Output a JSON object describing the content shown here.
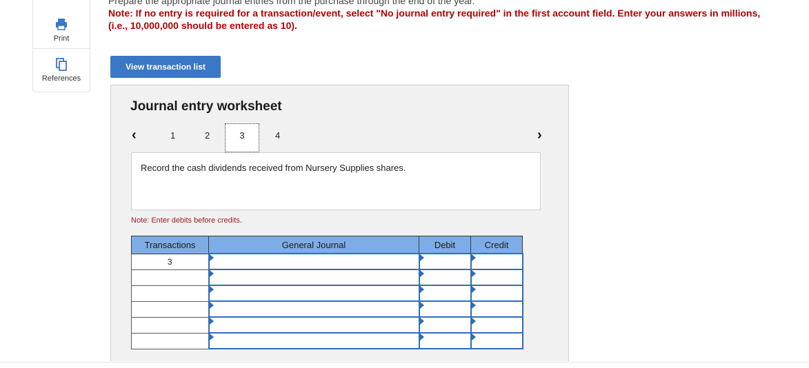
{
  "sidebar": {
    "print_label": "Print",
    "references_label": "References"
  },
  "instructions": {
    "top_text": "Prepare the appropriate journal entries from the purchase through the end of the year.",
    "note": "Note: If no entry is required for a transaction/event, select \"No journal entry required\" in the first account field. Enter your answers in millions, (i.e., 10,000,000 should be entered as 10)."
  },
  "toolbar": {
    "view_transaction_list": "View transaction list"
  },
  "worksheet": {
    "title": "Journal entry worksheet",
    "pages": [
      "1",
      "2",
      "3",
      "4"
    ],
    "current_page": "3",
    "description": "Record the cash dividends received from Nursery Supplies shares.",
    "note": "Note: Enter debits before credits."
  },
  "table": {
    "headers": [
      "Transactions",
      "General Journal",
      "Debit",
      "Credit"
    ],
    "rows": [
      {
        "transaction": "3",
        "account": "",
        "debit": "",
        "credit": ""
      },
      {
        "transaction": "",
        "account": "",
        "debit": "",
        "credit": ""
      },
      {
        "transaction": "",
        "account": "",
        "debit": "",
        "credit": ""
      },
      {
        "transaction": "",
        "account": "",
        "debit": "",
        "credit": ""
      },
      {
        "transaction": "",
        "account": "",
        "debit": "",
        "credit": ""
      },
      {
        "transaction": "",
        "account": "",
        "debit": "",
        "credit": ""
      }
    ]
  },
  "colors": {
    "accent": "#3a77c4",
    "header_bg": "#7eade6",
    "note_red": "#b30000"
  }
}
